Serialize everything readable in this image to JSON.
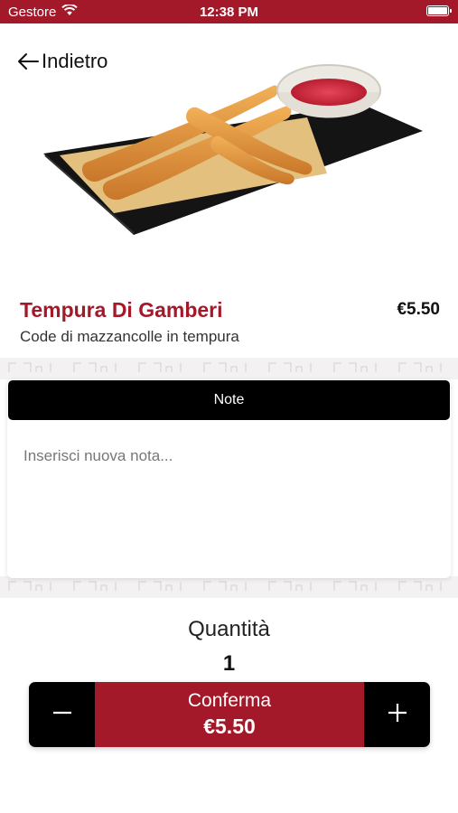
{
  "status_bar": {
    "carrier": "Gestore",
    "time": "12:38 PM"
  },
  "nav": {
    "back_label": "Indietro"
  },
  "product": {
    "name": "Tempura Di Gamberi",
    "price": "€5.50",
    "description": "Code di mazzancolle in tempura"
  },
  "notes": {
    "header": "Note",
    "placeholder": "Inserisci nuova nota...",
    "value": ""
  },
  "quantity": {
    "label": "Quantità",
    "value": "1"
  },
  "action_bar": {
    "confirm_label": "Conferma",
    "total": "€5.50"
  },
  "colors": {
    "brand_red": "#a3192a",
    "black": "#000000"
  }
}
